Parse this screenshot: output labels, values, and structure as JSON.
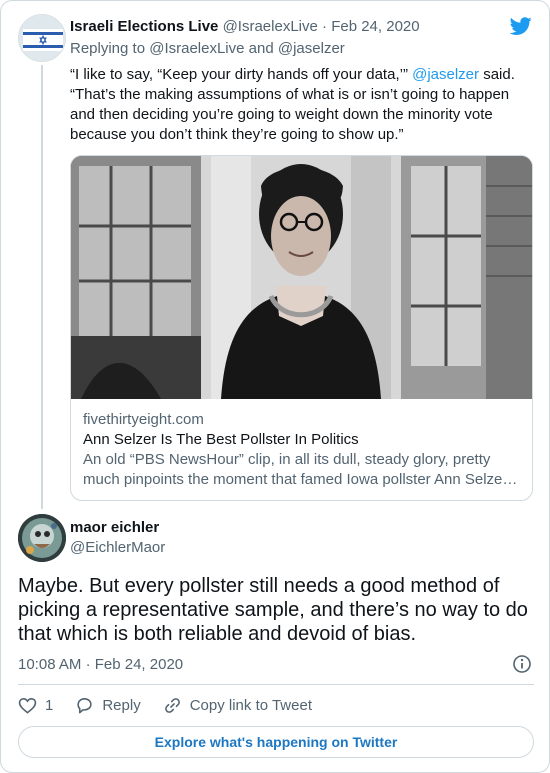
{
  "parent_tweet": {
    "author_name": "Israeli Elections Live",
    "author_handle": "@IsraelexLive",
    "separator": "·",
    "date": "Feb 24, 2020",
    "replying_to_prefix": "Replying to",
    "replying_to_user1": "@IsraelexLive",
    "replying_to_and": "and",
    "replying_to_user2": "@jaselzer",
    "text_part1": "“I like to say, “Keep your dirty hands off your data,’” ",
    "mention": "@jaselzer",
    "text_part2": " said. “That’s the making assumptions of what is or isn’t going to happen and then deciding you’re going to weight down the minority vote because you don’t think they’re going to show up.”",
    "link_card": {
      "domain": "fivethirtyeight.com",
      "title": "Ann Selzer Is The Best Pollster In Politics",
      "description_line1": "An old “PBS NewsHour” clip, in all its dull, steady glory, pretty",
      "description_line2": "much pinpoints the moment that famed Iowa pollster Ann Selze…"
    }
  },
  "reply_tweet": {
    "author_name": "maor eichler",
    "author_handle": "@EichlerMaor",
    "text": "Maybe. But every pollster still needs a good method of picking a representative sample, and there’s no way to do that which is both reliable and devoid of bias.",
    "time": "10:08 AM",
    "separator": "·",
    "date": "Feb 24, 2020"
  },
  "actions": {
    "like_count": "1",
    "reply_label": "Reply",
    "copy_link_label": "Copy link to Tweet"
  },
  "explore_button": "Explore what's happening on Twitter",
  "icons": {
    "brand": "twitter-bird-icon",
    "info": "info-icon",
    "like": "heart-icon",
    "reply": "reply-bubble-icon",
    "copy_link": "link-icon"
  },
  "colors": {
    "accent": "#1d9bf0",
    "muted": "#536471",
    "border": "#cfd9de",
    "explore_text": "#1d77c2"
  }
}
